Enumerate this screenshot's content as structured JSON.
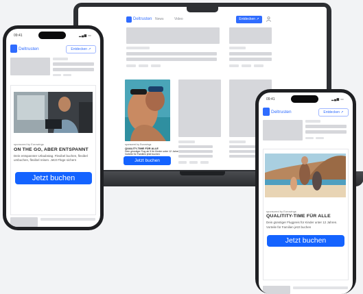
{
  "laptop": {
    "brand": "Deltrusten",
    "nav": [
      "News",
      "Video"
    ],
    "header_button": "Entdecken ↗",
    "user_icon": "person-icon",
    "ad": {
      "sponsor": "sponsored by Eurowings",
      "title": "Quality-Time für alle",
      "body_lines": [
        "Dein günstiger Flug ab 5 für Kinder unter 12 Jahren",
        "Vorteile für Familien jetzt buchen"
      ],
      "cta": "Jetzt buchen"
    }
  },
  "phone_left": {
    "status_time": "09:41",
    "brand": "Deltrusten",
    "header_button": "Entdecken ↗",
    "ad": {
      "sponsor": "sponsored by Eurowings",
      "title": "ON THE GO, ABER ENTSPANNT",
      "body_lines": [
        "Dein entspannter Urlaubstag. Flexibel buchen, flexibel",
        "umbuchen, flexibel reisen. Jetzt Flüge sichern"
      ],
      "cta": "Jetzt buchen"
    }
  },
  "phone_right": {
    "status_time": "09:41",
    "brand": "Deltrusten",
    "header_button": "Entdecken ↗",
    "ad": {
      "sponsor": "sponsored by Eurowings",
      "title": "QUALITITY-TIME FÜR ALLE",
      "body_lines": [
        "Dein günstiger Flugpreis für Kinder unter 12 Jahren.",
        "Vorteile für Familien jetzt buchen"
      ],
      "cta": "Jetzt buchen"
    }
  },
  "colors": {
    "brand_blue": "#2f6cff",
    "cta_blue": "#1463ff",
    "device_dark": "#1f2023"
  }
}
